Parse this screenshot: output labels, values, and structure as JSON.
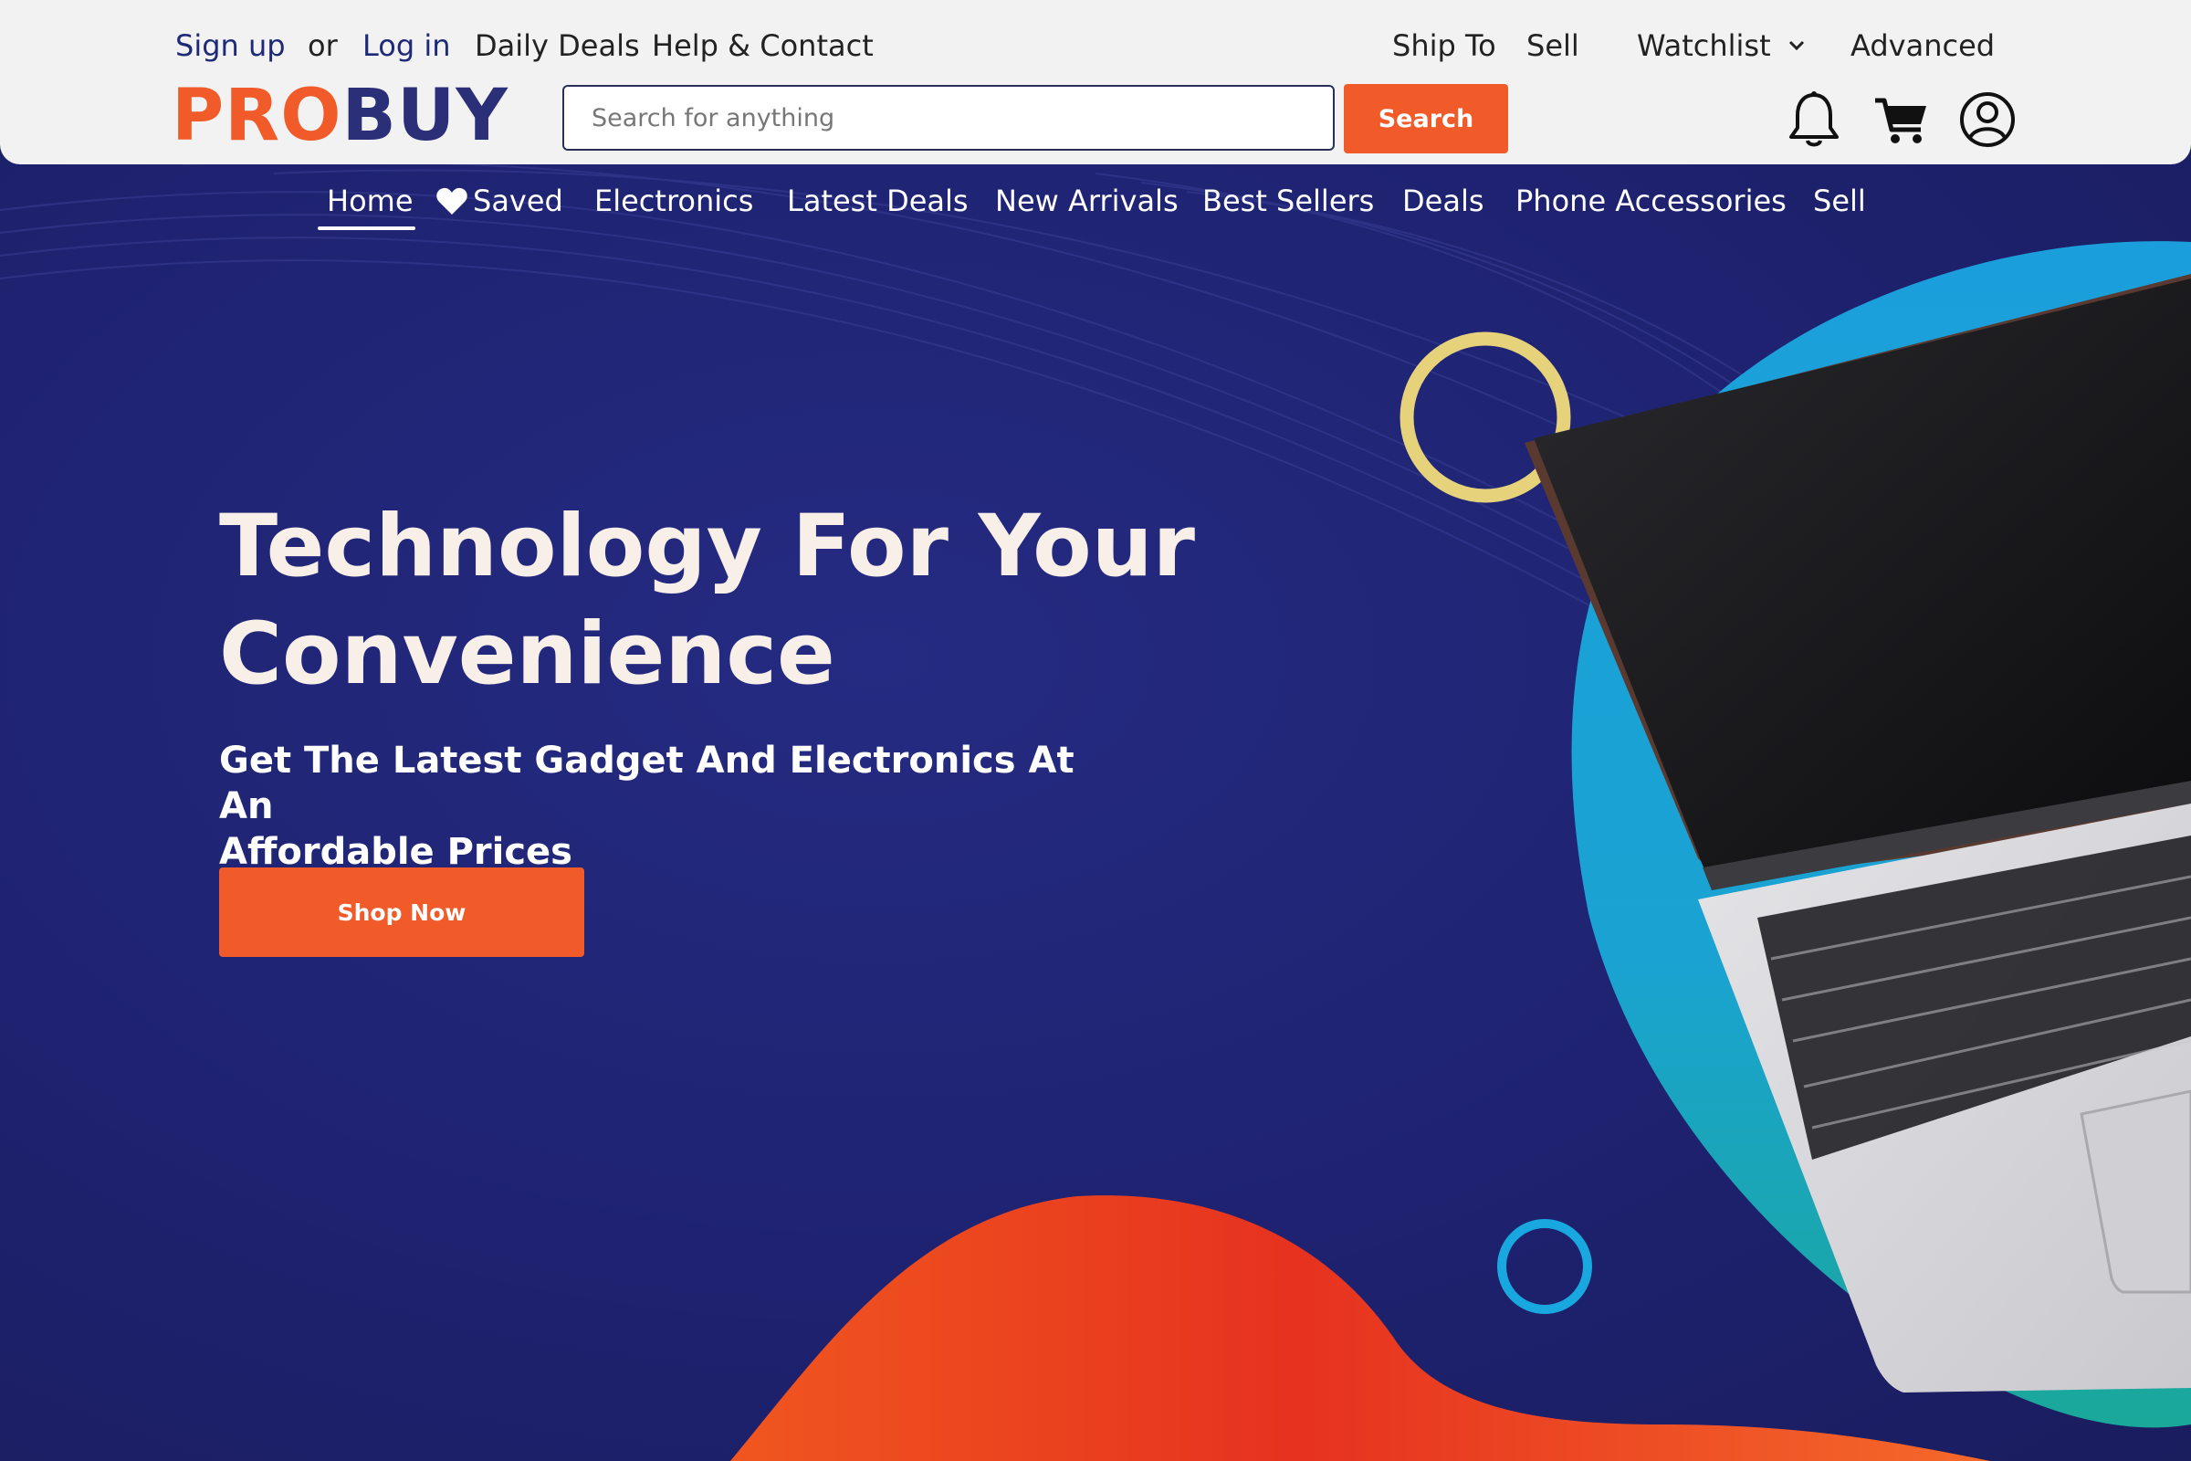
{
  "header": {
    "top_links": {
      "sign_up": "Sign up",
      "or": "or",
      "log_in": "Log in",
      "daily_deals": "Daily Deals",
      "help_contact": "Help & Contact",
      "ship_to": "Ship To",
      "sell": "Sell",
      "watchlist": "Watchlist",
      "advanced": "Advanced"
    },
    "logo": {
      "part1": "PRO",
      "part2": "BUY"
    },
    "search": {
      "placeholder": "Search for anything",
      "button_label": "Search"
    },
    "icons": [
      "bell-icon",
      "cart-icon",
      "user-account-icon",
      "chevron-down-icon"
    ]
  },
  "nav": {
    "items": [
      {
        "label": "Home",
        "active": true
      },
      {
        "label": "Saved",
        "icon": "heart-icon"
      },
      {
        "label": "Electronics"
      },
      {
        "label": "Latest Deals"
      },
      {
        "label": "New Arrivals"
      },
      {
        "label": "Best Sellers"
      },
      {
        "label": "Deals"
      },
      {
        "label": "Phone Accessories"
      },
      {
        "label": "Sell"
      }
    ]
  },
  "hero": {
    "headline_line1": "Technology For Your",
    "headline_line2": "Convenience",
    "subline_line1": "Get The Latest Gadget And Electronics At An",
    "subline_line2": "Affordable Prices",
    "cta_label": "Shop Now"
  },
  "colors": {
    "accent": "#f15a29",
    "brand_dark": "#2a2f78",
    "hero_bg": "#1e2270",
    "teal_blob": "#1aa6d6",
    "yellow_ring": "#e6d27a",
    "blue_ring": "#19a7df"
  }
}
